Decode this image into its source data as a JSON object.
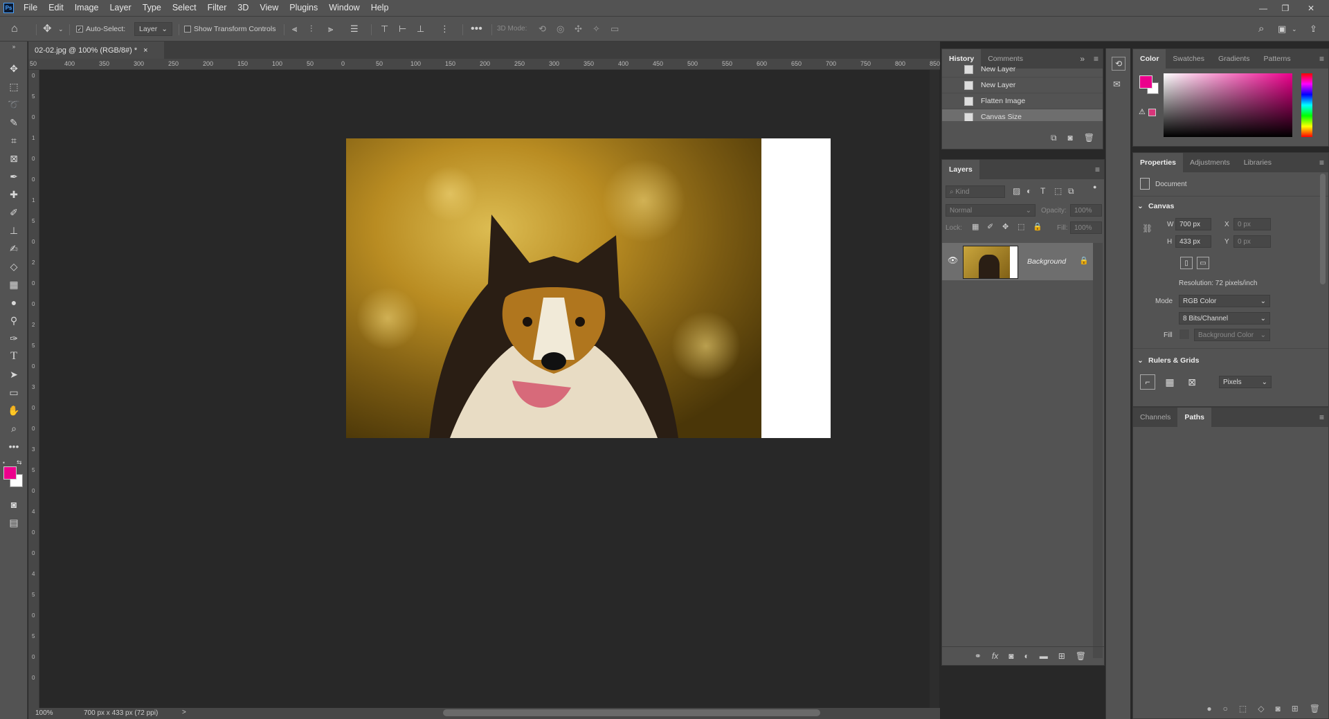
{
  "app": {
    "logo": "Ps"
  },
  "menubar": {
    "items": [
      "File",
      "Edit",
      "Image",
      "Layer",
      "Type",
      "Select",
      "Filter",
      "3D",
      "View",
      "Plugins",
      "Window",
      "Help"
    ]
  },
  "window_controls": {
    "minimize": "—",
    "restore": "❐",
    "close": "✕"
  },
  "options": {
    "auto_select_label": "Auto-Select:",
    "auto_select_checked": true,
    "auto_select_target": "Layer",
    "show_transform_label": "Show Transform Controls",
    "show_transform_checked": false,
    "mode_3d_label": "3D Mode:"
  },
  "document_tab": {
    "title": "02-02.jpg @ 100% (RGB/8#) *",
    "close": "×"
  },
  "ruler": {
    "h_labels": [
      "50",
      "400",
      "350",
      "300",
      "250",
      "200",
      "150",
      "100",
      "50",
      "0",
      "50",
      "100",
      "150",
      "200",
      "250",
      "300",
      "350",
      "400",
      "450",
      "500",
      "550",
      "600",
      "650",
      "700",
      "750",
      "800",
      "850"
    ],
    "v_labels": [
      "0",
      "5",
      "0",
      "1",
      "0",
      "0",
      "1",
      "5",
      "0",
      "2",
      "0",
      "0",
      "2",
      "5",
      "0",
      "3",
      "0",
      "0",
      "3",
      "5",
      "0",
      "4",
      "0",
      "0",
      "4",
      "5",
      "0",
      "5",
      "0",
      "0"
    ]
  },
  "status": {
    "zoom": "100%",
    "doc_info": "700 px x 433 px (72 ppi)",
    "next": ">"
  },
  "colors": {
    "foreground": "#ec008c",
    "background": "#ffffff",
    "accent": "#31a8ff",
    "swatch_warning": "#d8357a"
  },
  "history": {
    "tabs": [
      "History",
      "Comments"
    ],
    "active_tab": "History",
    "items": [
      {
        "label": "New Layer",
        "selected": false
      },
      {
        "label": "New Layer",
        "selected": false
      },
      {
        "label": "Flatten Image",
        "selected": false
      },
      {
        "label": "Canvas Size",
        "selected": true
      }
    ]
  },
  "layers": {
    "tab": "Layers",
    "filter_placeholder": "Kind",
    "blend_mode": "Normal",
    "opacity_label": "Opacity:",
    "opacity_value": "100%",
    "lock_label": "Lock:",
    "fill_label": "Fill:",
    "fill_value": "100%",
    "items": [
      {
        "name": "Background",
        "visible": true,
        "locked": true
      }
    ]
  },
  "color_panel": {
    "tabs": [
      "Color",
      "Swatches",
      "Gradients",
      "Patterns"
    ],
    "active_tab": "Color"
  },
  "properties": {
    "tabs": [
      "Properties",
      "Adjustments",
      "Libraries"
    ],
    "active_tab": "Properties",
    "doc_label": "Document",
    "canvas_section": "Canvas",
    "w_label": "W",
    "w_value": "700 px",
    "h_label": "H",
    "h_value": "433 px",
    "x_label": "X",
    "x_value": "0 px",
    "y_label": "Y",
    "y_value": "0 px",
    "resolution": "Resolution: 72 pixels/inch",
    "mode_label": "Mode",
    "mode_value": "RGB Color",
    "depth_value": "8 Bits/Channel",
    "fill_label": "Fill",
    "fill_value": "Background Color",
    "rulers_section": "Rulers & Grids",
    "units_value": "Pixels"
  },
  "paths_panel": {
    "tabs": [
      "Channels",
      "Paths"
    ],
    "active_tab": "Paths"
  }
}
